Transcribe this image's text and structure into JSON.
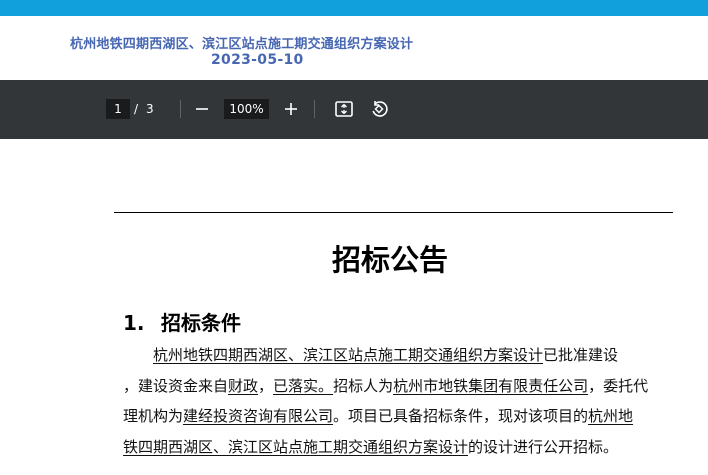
{
  "header": {
    "title": "杭州地铁四期西湖区、滨江区站点施工期交通组织方案设计",
    "date": "2023-05-10"
  },
  "toolbar": {
    "current_page": "1",
    "separator": "/",
    "total_pages": "3",
    "zoom": "100%"
  },
  "document": {
    "title": "招标公告",
    "section_number": "1.",
    "section_title": "招标条件",
    "para": {
      "l1_indent": "　　",
      "l1_u1": "杭州地铁四期西湖区、滨江区站点施工期交通组织方案设计",
      "l1_t1": "已批准建设",
      "l2_t1": "，建设资金来自",
      "l2_u1": "财政",
      "l2_t2": "，",
      "l2_u2": "已落实。",
      "l2_t3": "招标人为",
      "l2_u3": "杭州市地铁集团有限责任公司",
      "l2_t4": "，委托代",
      "l3_t1": "理机构为",
      "l3_u1": "建经投资咨询有限公司",
      "l3_t2": "。项目已具备招标条件，现对该项目的",
      "l3_u2": "杭州地",
      "l4_u1": "铁四期西湖区、滨江区站点施工期交通组织方案设计",
      "l4_t1": "的设计进行公开招标。"
    }
  },
  "colors": {
    "top_bar": "#12a0dc",
    "header_text": "#4767b3",
    "toolbar_bg": "#323639"
  },
  "icons": [
    "minus-icon",
    "plus-icon",
    "fit-page-icon",
    "rotate-icon"
  ]
}
